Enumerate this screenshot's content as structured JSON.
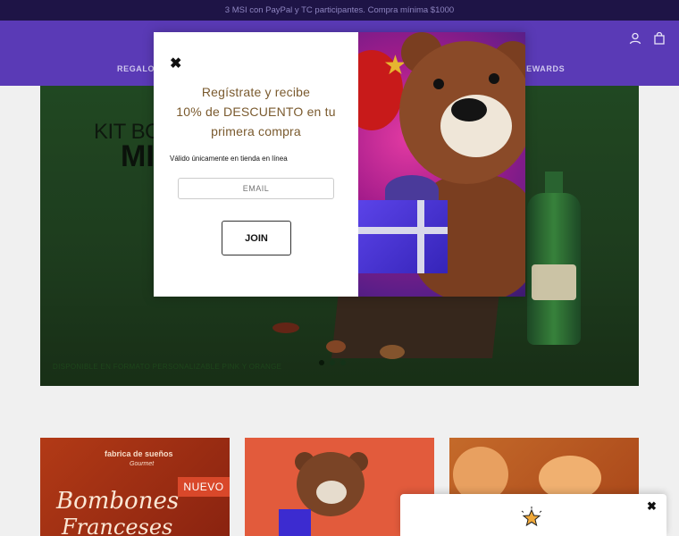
{
  "announcement": {
    "text": "3 MSI con PayPal y TC participantes. Compra mínima $1000"
  },
  "header": {
    "nav": [
      {
        "label": "REGALOS"
      },
      {
        "label": "REWARDS"
      }
    ],
    "icons": {
      "account": "user-icon",
      "cart": "shopping-bag-icon"
    }
  },
  "hero": {
    "title_line1": "KIT BOTA",
    "title_line2": "MI",
    "caption": "DISPONIBLE EN FORMATO PERSONALIZABLE PINK Y ORANGE"
  },
  "cards": [
    {
      "brand": "fabrica de sueños",
      "brand_sub": "Gourmet",
      "badge": "NUEVO",
      "script_line1": "Bombones",
      "script_line2": "Franceses"
    },
    {
      "name": "bear-gift"
    },
    {
      "name": "cookies"
    }
  ],
  "modal": {
    "close_icon": "close-icon",
    "heading": [
      "Regístrate y recibe",
      "10% de DESCUENTO en tu",
      "primera compra"
    ],
    "note": "Válido únicamente en tienda en línea",
    "email_placeholder": "EMAIL",
    "join_label": "JOIN"
  },
  "widget": {
    "close_icon": "close-icon",
    "icon": "star-icon"
  },
  "colors": {
    "announcement_bg": "#1e1446",
    "header_bg": "#5a3ab6",
    "hero_bg": "#234d25",
    "modal_heading": "#7a5a2e"
  }
}
